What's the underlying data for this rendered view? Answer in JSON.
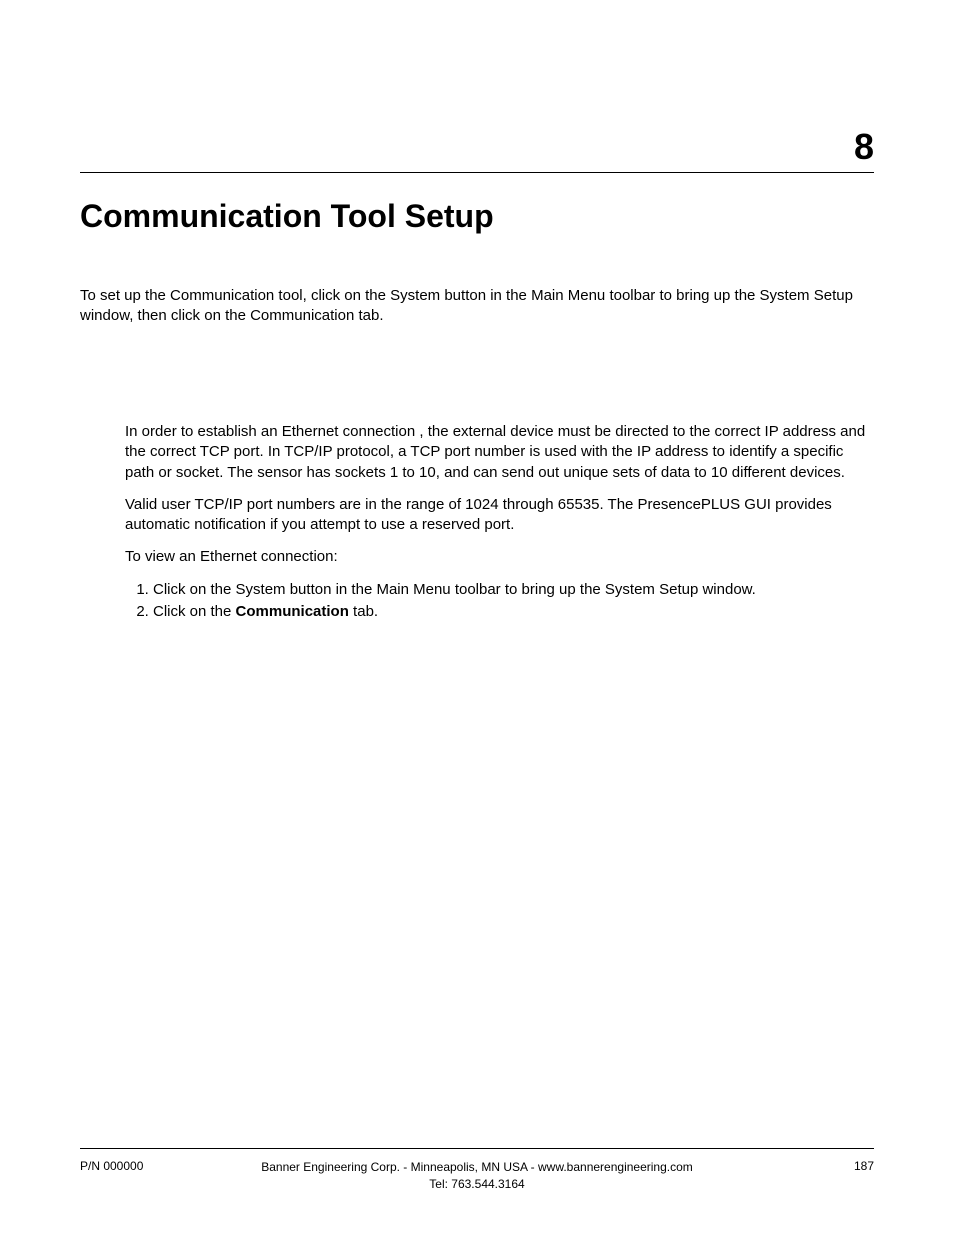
{
  "header": {
    "chapter_number": "8",
    "chapter_title": "Communication Tool Setup"
  },
  "intro": "To set up the Communication tool, click on the System button in the Main Menu toolbar to bring up the System Setup window, then click on the Communication tab.",
  "body": {
    "p1": "In order to establish an Ethernet connection , the external device must be directed to the correct IP address and the correct TCP port. In TCP/IP protocol, a TCP port number is used with the IP address to identify a specific path or socket. The sensor has sockets 1 to 10, and can send out unique sets of data to 10 different devices.",
    "p2": "Valid user TCP/IP port numbers are in the range of 1024 through 65535. The PresencePLUS GUI provides automatic notification if you attempt to use a reserved port.",
    "p3": "To view an Ethernet connection:",
    "step1": "Click on the System button in the Main Menu toolbar to bring up the System Setup window.",
    "step2_prefix": "Click on the ",
    "step2_bold": "Communication",
    "step2_suffix": " tab."
  },
  "footer": {
    "part_number": "P/N 000000",
    "company_line1": "Banner Engineering Corp. - Minneapolis, MN USA - www.bannerengineering.com",
    "company_line2": "Tel: 763.544.3164",
    "page_number": "187"
  }
}
